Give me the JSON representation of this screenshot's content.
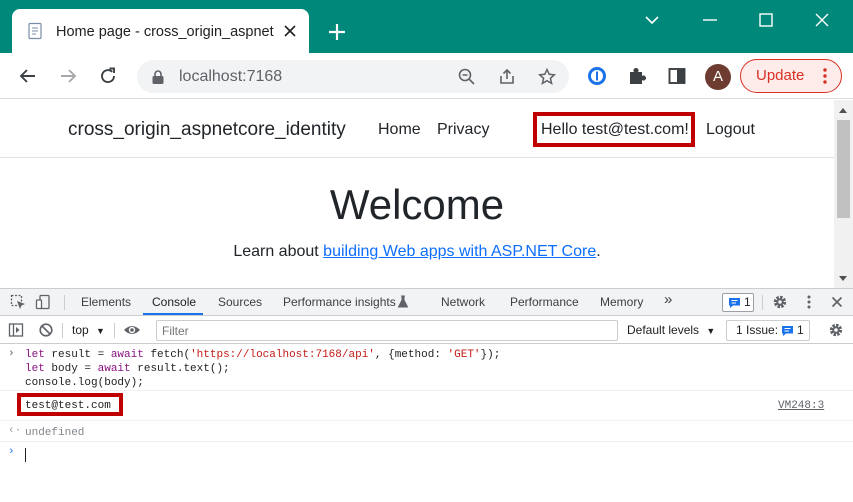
{
  "browser": {
    "tab_title": "Home page - cross_origin_aspnetcore_identity",
    "url": "localhost:7168",
    "update_label": "Update",
    "avatar_letter": "A",
    "frame_color": "#00897b"
  },
  "page": {
    "brand": "cross_origin_aspnetcore_identity",
    "nav": {
      "home": "Home",
      "privacy": "Privacy",
      "hello": "Hello test@test.com!",
      "logout": "Logout"
    },
    "welcome": "Welcome",
    "learn_prefix": "Learn about ",
    "learn_link": "building Web apps with ASP.NET Core",
    "learn_suffix": ".",
    "link_color": "#0d6efd"
  },
  "devtools": {
    "tabs": [
      "Elements",
      "Console",
      "Sources",
      "Performance insights",
      "Network",
      "Performance",
      "Memory"
    ],
    "more_tabs": "»",
    "message_badge_count": "1",
    "context": "top",
    "filter_placeholder": "Filter",
    "levels": "Default levels",
    "issues_label": "1 Issue:",
    "issues_count": "1",
    "console": {
      "input_line1": {
        "kw1": "let",
        "pre1": " result = ",
        "kw2": "await",
        "pre2": " fetch(",
        "str1": "'https://localhost:7168/api'",
        "pre3": ", {method: ",
        "str2": "'GET'",
        "pre4": "});"
      },
      "input_line2": {
        "kw1": "let",
        "pre1": " body = ",
        "kw2": "await",
        "pre2": " result.text();"
      },
      "input_line3": "console.log(body);",
      "log_output": "test@test.com",
      "log_source": "VM248:3",
      "return_value": "undefined"
    },
    "highlight_color": "#c00000"
  }
}
